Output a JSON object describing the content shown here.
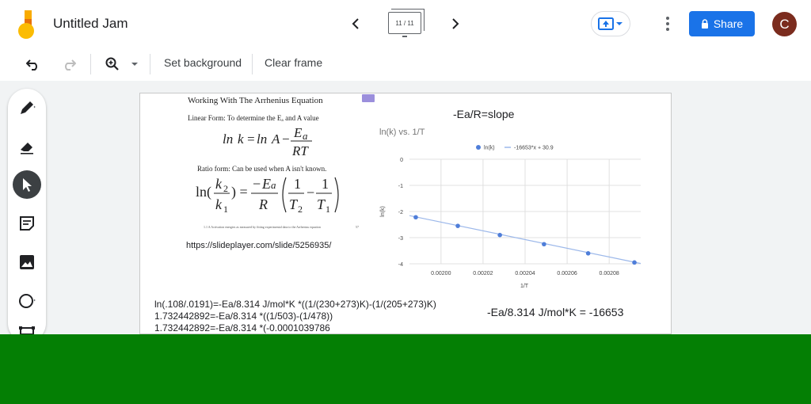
{
  "app": {
    "title": "Untitled Jam",
    "frame_counter": "11 / 11",
    "share_label": "Share",
    "avatar_initial": "C"
  },
  "colors": {
    "accent": "#1a73e8",
    "avatar_bg": "#7b2c1e",
    "green_overlay": "#047f04",
    "series": "#4f7ed9"
  },
  "toolbar": {
    "set_background": "Set background",
    "clear_frame": "Clear frame"
  },
  "icons": {
    "top": [
      "jamboard-logo-icon",
      "chevron-left-icon",
      "frames-icon",
      "chevron-right-icon",
      "present-icon",
      "more-vert-icon",
      "lock-icon"
    ],
    "toolbar": [
      "undo-icon",
      "redo-icon",
      "zoom-icon",
      "caret-down-icon"
    ],
    "side": [
      "pen-icon",
      "eraser-icon",
      "select-icon",
      "sticky-note-icon",
      "image-icon",
      "circle-icon",
      "text-box-icon"
    ]
  },
  "slide": {
    "screenshot": {
      "heading": "Working With The Arrhenius Equation",
      "linear_form": "Linear Form: To determine the Eₐ and A value",
      "eq_linear": "ln k = ln A − Ea / RT",
      "ratio_form": "Ratio form: Can be used when A isn't known.",
      "eq_ratio": "ln(k2/k1) = −Ea/R (1/T2 − 1/T1)",
      "caption": "1.1 A Activation energies as measured by fitting experimental data to the Arrhenius equation",
      "page_number": "57",
      "source": "https://slideplayer.com/slide/5256935/"
    },
    "slope_note": "-Ea/R=slope",
    "calc_lines": [
      "ln(.108/.0191)=-Ea/8.314 J/mol*K *((1/(230+273)K)-(1/(205+273)K)",
      "1.732442892=-Ea/8.314 *((1/503)-(1/478))",
      "1.732442892=-Ea/8.314 *(-0.0001039786"
    ],
    "rhs_line": "-Ea/8.314 J/mol*K = -16653"
  },
  "chart_data": {
    "type": "scatter",
    "title": "ln(k) vs. 1/T",
    "xlabel": "1/T",
    "ylabel": "ln(k)",
    "legend": [
      "ln(k)",
      "-16653*x + 30.9"
    ],
    "legend_position": "top",
    "xlim": [
      0.001985,
      0.002095
    ],
    "ylim": [
      -4,
      0
    ],
    "x_ticks": [
      0.002,
      0.00202,
      0.00204,
      0.00206,
      0.00208
    ],
    "x_tick_labels": [
      "0.00200",
      "0.00202",
      "0.00204",
      "0.00206",
      "0.00208"
    ],
    "y_ticks": [
      0,
      -1,
      -2,
      -3,
      -4
    ],
    "y_tick_labels": [
      "0",
      "-1",
      "-2",
      "-3",
      "-4"
    ],
    "grid": true,
    "series": [
      {
        "name": "ln(k)",
        "x": [
          0.001988,
          0.002008,
          0.002028,
          0.002049,
          0.00207,
          0.002092
        ],
        "y": [
          -2.22,
          -2.55,
          -2.9,
          -3.25,
          -3.6,
          -3.95
        ]
      }
    ],
    "trendline": {
      "slope": -16653,
      "intercept": 30.9
    }
  }
}
